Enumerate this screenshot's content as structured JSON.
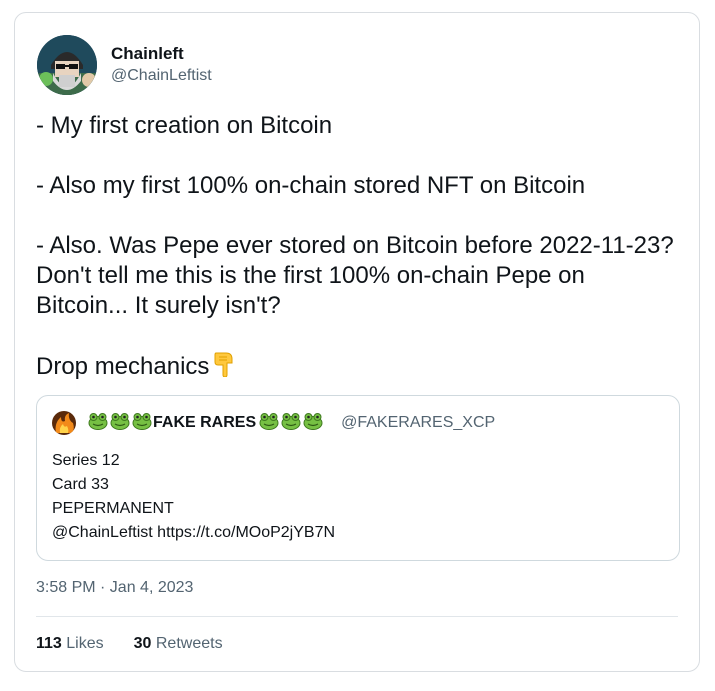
{
  "author": {
    "display_name": "Chainleft",
    "handle": "@ChainLeftist",
    "avatar_icon": "bearded-character-avatar-icon"
  },
  "tweet": {
    "lines": [
      "- My first creation on Bitcoin",
      "- Also my first 100% on-chain stored NFT on Bitcoin",
      "- Also. Was Pepe ever stored on Bitcoin before 2022-11-23? Don't tell me this is the first 100% on-chain Pepe on Bitcoin... It surely isn't?",
      "Drop mechanics"
    ],
    "emoji_icon": "backhand-index-pointing-down-icon"
  },
  "quote": {
    "display_name": "FAKE RARES",
    "handle": "@FAKERARES_XCP",
    "name_emoji": "frog-face-icon",
    "lines": [
      "Series 12",
      "Card 33",
      "PEPERMANENT",
      "@ChainLeftist https://t.co/MOoP2jYB7N"
    ]
  },
  "timestamp": "3:58 PM · Jan 4, 2023",
  "stats": {
    "likes_count": "113",
    "likes_label": "Likes",
    "retweets_count": "30",
    "retweets_label": "Retweets"
  },
  "colors": {
    "text_primary": "#0f1419",
    "text_secondary": "#536471",
    "border": "#d9dde1"
  }
}
